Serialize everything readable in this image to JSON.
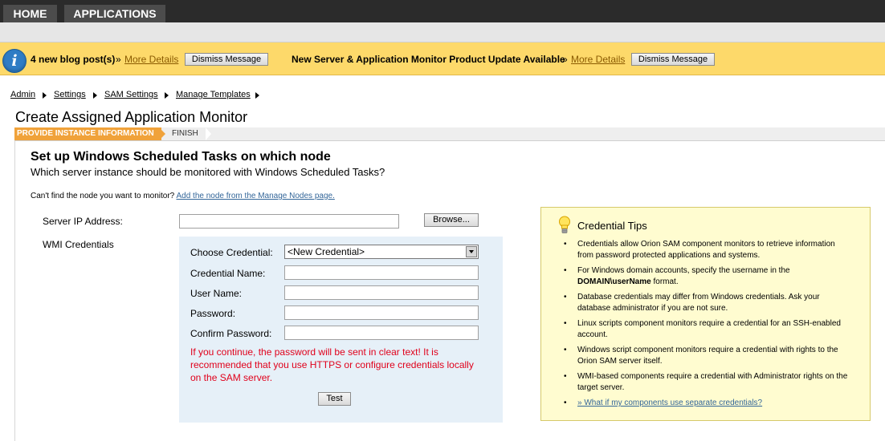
{
  "nav": {
    "home": "HOME",
    "applications": "APPLICATIONS"
  },
  "notice": {
    "blog_text": "4 new blog post(s)",
    "separator": "»",
    "more_details": "More Details",
    "dismiss": "Dismiss Message",
    "update_text": "New Server & Application Monitor Product Update Available",
    "more_details2": "More Details",
    "dismiss2": "Dismiss Message"
  },
  "breadcrumb": [
    "Admin",
    "Settings",
    "SAM Settings",
    "Manage Templates"
  ],
  "page_title": "Create Assigned Application Monitor",
  "wizard": {
    "step1": "PROVIDE INSTANCE INFORMATION",
    "step2": "FINISH"
  },
  "form": {
    "heading": "Set up Windows Scheduled Tasks on which node",
    "subheading": "Which server instance should be monitored with Windows Scheduled Tasks?",
    "cant_find": "Can't find the node you want to monitor?",
    "add_node_link": "Add the node from the Manage Nodes page.",
    "server_ip_label": "Server IP Address:",
    "browse": "Browse...",
    "wmi_label": "WMI Credentials",
    "choose_credential_label": "Choose Credential:",
    "choose_credential_value": "<New Credential>",
    "credential_name_label": "Credential Name:",
    "user_name_label": "User Name:",
    "password_label": "Password:",
    "confirm_password_label": "Confirm Password:",
    "warning": "If you continue, the password will be sent in clear text! It is recommended that you use HTTPS or configure credentials locally on the SAM server.",
    "test": "Test"
  },
  "tips": {
    "title": "Credential Tips",
    "items": [
      "Credentials allow Orion SAM component monitors to retrieve information from password protected applications and systems.",
      "For Windows domain accounts, specify the username in the",
      "DOMAIN\\userName",
      "format.",
      "Database credentials may differ from Windows credentials. Ask your database administrator if you are not sure.",
      "Linux scripts component monitors require a credential for an SSH-enabled account.",
      "Windows script component monitors require a credential with rights to the Orion SAM server itself.",
      "WMI-based components require a credential with Administrator rights on the target server.",
      "» What if my components use separate credentials?"
    ]
  },
  "colors": {
    "notice_bg": "#fdd96a",
    "step_active": "#f0a23a",
    "warning": "#e0001b",
    "tips_bg": "#fffcd0",
    "cred_bg": "#e6f0f8"
  }
}
